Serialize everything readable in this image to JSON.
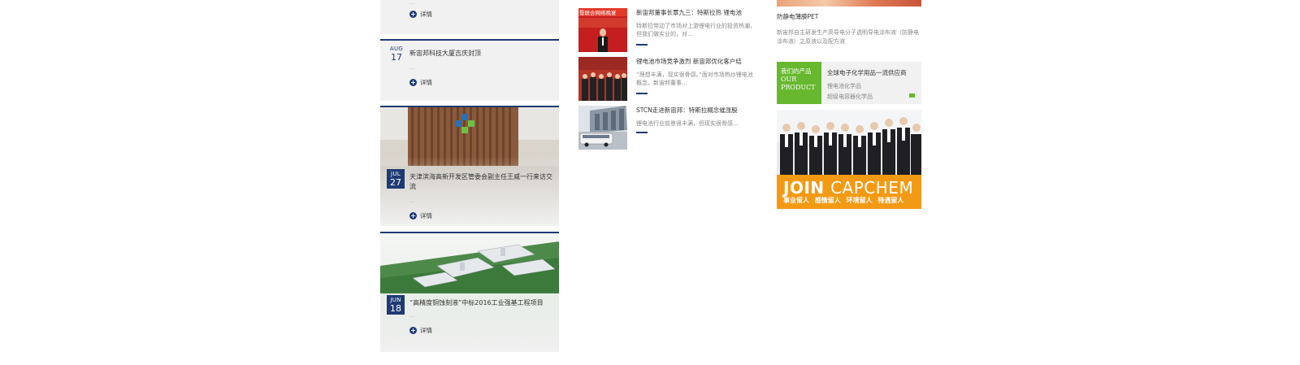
{
  "left_news": [
    {
      "month": "",
      "day": "",
      "title": "",
      "more_label": "详情"
    },
    {
      "month": "AUG",
      "day": "17",
      "title": "新宙邦科技大厦吉庆封顶",
      "dots": "...",
      "more_label": "详情"
    },
    {
      "month": "JUL",
      "day": "27",
      "title": "天津滨海高新开发区管委会副主任王威一行来访交流",
      "dots": "...",
      "more_label": "详情"
    },
    {
      "month": "JUN",
      "day": "18",
      "title": "“高精度铜蚀刻液”中标2016工业强基工程项目",
      "dots": "...",
      "more_label": "详情"
    }
  ],
  "mid_news": [
    {
      "title": "新宙邦董事长覃九三：特斯拉热 锂电池",
      "summary": "特斯拉带动了市场对上游锂电行业的投资热潮，但我们做实业的，对...",
      "thumb_text": "暨联合网络晚宴"
    },
    {
      "title": "锂电池市场竞争激烈 新宙邦优化客户结",
      "summary": "“理想丰满，现实很骨感。”面对市场热炒锂电池概念，新宙邦董事..."
    },
    {
      "title": "STCN走进新宙邦：特斯拉概念催涨股",
      "summary": "锂电池行业前景很丰满，但现实很骨感..."
    }
  ],
  "right_col": {
    "feature_title": "防静电薄膜PET",
    "feature_desc": "新宙邦自主研发生产高导电分子透明导电涂布液（防静电涂布液）之原液以及配方液",
    "product": {
      "label_cn": "我们的产品",
      "label_en_1": "OUR",
      "label_en_2": "PRODUCT",
      "title": "全球电子化学用品一流供应商",
      "items": [
        "锂电池化学品",
        "超级电容器化学品"
      ]
    },
    "join": {
      "word_1": "JOIN",
      "word_2": "CAPCHEM",
      "subtitle": "事业留人 感情留人 环境留人 待遇留人"
    }
  },
  "colors": {
    "navy": "#1f3a73",
    "green": "#68b82f",
    "orange": "#f39a14",
    "card_bg": "#f1f1f1"
  }
}
